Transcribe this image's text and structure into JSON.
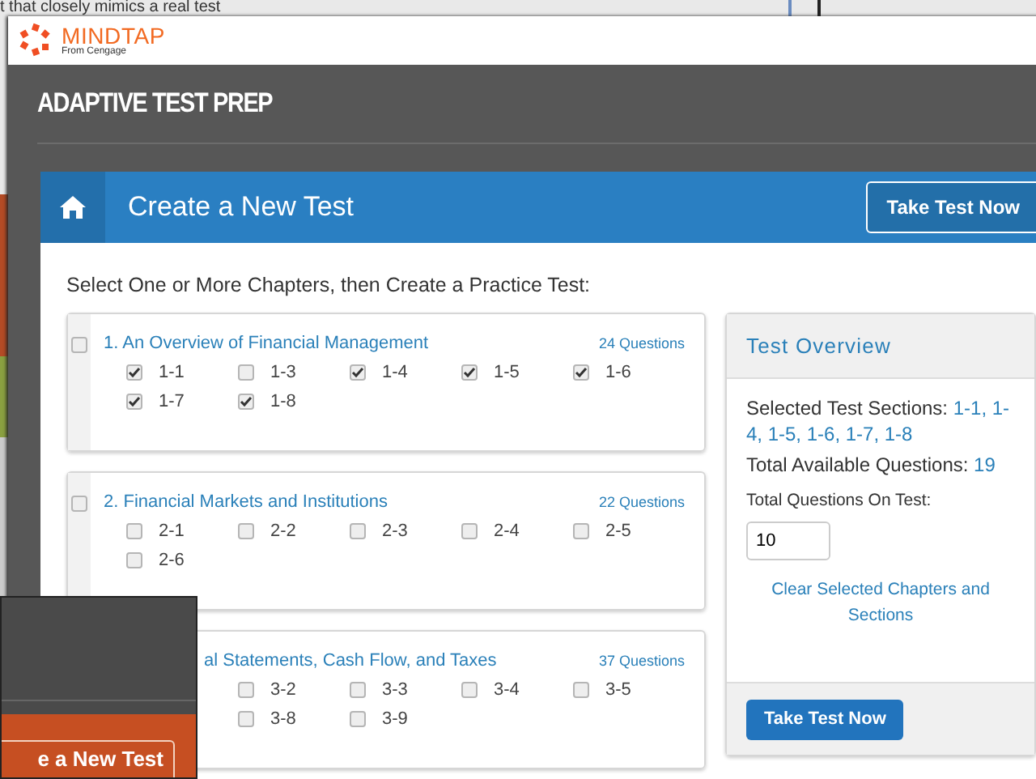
{
  "background_page": {
    "text": "t that closely mimics a real test"
  },
  "window": {
    "brand": "MINDTAP",
    "brand_subtitle": "From Cengage",
    "title": "ADAPTIVE TEST PREP"
  },
  "header": {
    "title": "Create a New Test",
    "button": "Take Test Now"
  },
  "instructions": "Select One or More Chapters, then Create a Practice Test:",
  "chapters": [
    {
      "title": "1. An Overview of Financial Management",
      "questions": "24 Questions",
      "checked": false,
      "covered": false,
      "rows": [
        [
          {
            "label": "1-1",
            "checked": true
          },
          {
            "label": "1-3",
            "checked": false
          },
          {
            "label": "1-4",
            "checked": true
          },
          {
            "label": "1-5",
            "checked": true
          },
          {
            "label": "1-6",
            "checked": true
          }
        ],
        [
          {
            "label": "1-7",
            "checked": true
          },
          {
            "label": "1-8",
            "checked": true
          }
        ]
      ]
    },
    {
      "title": "2. Financial Markets and Institutions",
      "questions": "22 Questions",
      "checked": false,
      "covered": false,
      "rows": [
        [
          {
            "label": "2-1",
            "checked": false
          },
          {
            "label": "2-2",
            "checked": false
          },
          {
            "label": "2-3",
            "checked": false
          },
          {
            "label": "2-4",
            "checked": false
          },
          {
            "label": "2-5",
            "checked": false
          }
        ],
        [
          {
            "label": "2-6",
            "checked": false
          }
        ]
      ]
    },
    {
      "title": "al Statements, Cash Flow, and Taxes",
      "questions": "37 Questions",
      "covered": true,
      "rows": [
        [
          {
            "label": "3-2",
            "checked": false
          },
          {
            "label": "3-3",
            "checked": false
          },
          {
            "label": "3-4",
            "checked": false
          },
          {
            "label": "3-5",
            "checked": false
          }
        ],
        [
          {
            "label": "3-8",
            "checked": false
          },
          {
            "label": "3-9",
            "checked": false
          }
        ]
      ]
    }
  ],
  "overview": {
    "title": "Test Overview",
    "sections_label": "Selected Test Sections:",
    "sections_value": "1-1, 1-4, 1-5, 1-6, 1-7, 1-8",
    "available_label": "Total Available Questions:",
    "available_value": "19",
    "total_label": "Total Questions On Test:",
    "total_value": "10",
    "clear_link": "Clear Selected Chapters and Sections",
    "button": "Take Test Now"
  },
  "overlay_window": {
    "button": "e a New Test"
  }
}
